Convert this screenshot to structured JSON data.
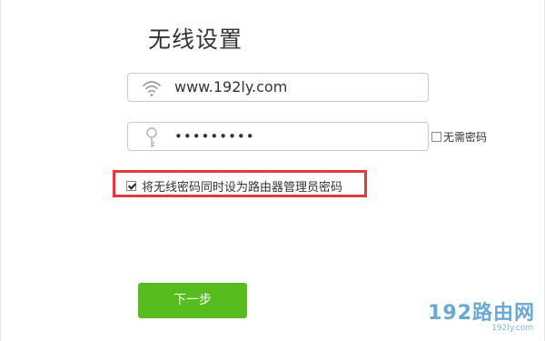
{
  "page": {
    "title": "无线设置"
  },
  "ssid": {
    "icon": "wifi-icon",
    "value": "www.192ly.com"
  },
  "password": {
    "icon": "key-icon",
    "value": "•••••••••",
    "no_password_label": "无需密码",
    "no_password_checked": false
  },
  "sync_option": {
    "label": "将无线密码同时设为路由器管理员密码",
    "checked": true,
    "highlight_color": "#e0393e"
  },
  "next_button": {
    "label": "下一步",
    "color": "#57bd1f"
  },
  "watermark": {
    "main": "192路由网",
    "domain": "192ly.com"
  }
}
